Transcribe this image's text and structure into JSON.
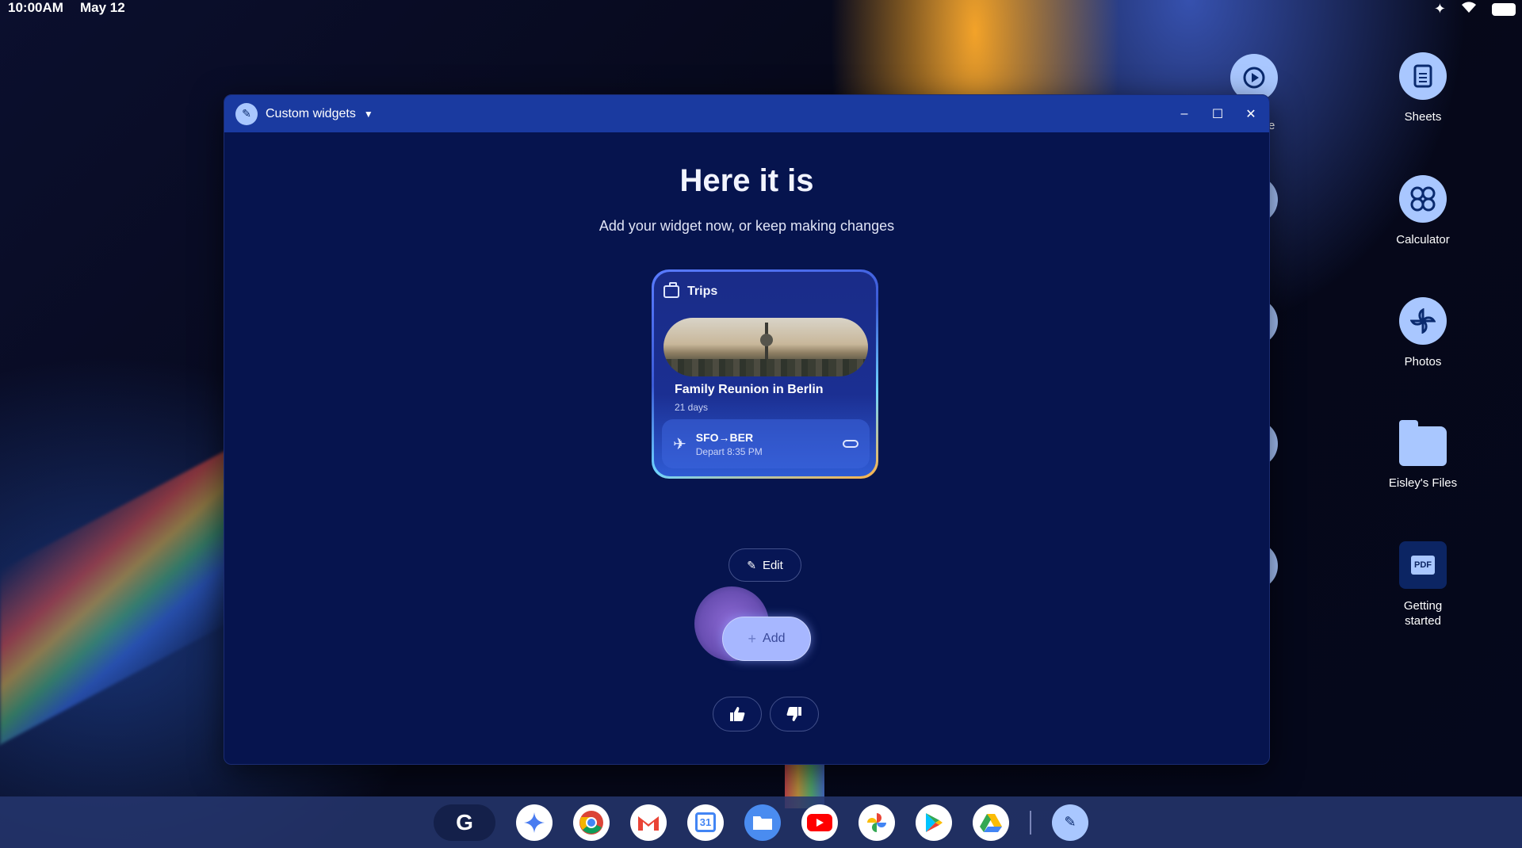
{
  "status_bar": {
    "time": "10:00AM",
    "date": "May 12",
    "icons": [
      "sparkle-icon",
      "wifi-icon",
      "battery-icon"
    ]
  },
  "desktop": {
    "items": [
      {
        "label": "Sheets",
        "icon": "sheets-icon"
      },
      {
        "label": "Calculator",
        "icon": "calculator-icon"
      },
      {
        "label": "Photos",
        "icon": "photos-icon"
      },
      {
        "label": "Eisley's Files",
        "icon": "folder-icon"
      },
      {
        "label": "Getting started",
        "icon": "pdf-icon",
        "badge": "PDF"
      }
    ],
    "partial_label": "e"
  },
  "window": {
    "title": "Custom widgets",
    "heading": "Here it is",
    "subheading": "Add your widget now, or keep making changes",
    "controls": {
      "minimize": "–",
      "maximize": "☐",
      "close": "✕"
    }
  },
  "widget": {
    "title": "Trips",
    "trip_name": "Family Reunion in Berlin",
    "trip_duration": "21 days",
    "flight_route": "SFO→BER",
    "flight_time": "Depart 8:35 PM"
  },
  "actions": {
    "edit_label": "Edit",
    "add_label": "Add"
  },
  "shelf": {
    "apps": [
      "launcher",
      "gemini",
      "chrome",
      "gmail",
      "calendar",
      "files",
      "youtube",
      "photos",
      "play-store",
      "drive",
      "custom-widgets"
    ],
    "calendar_day": "31"
  },
  "colors": {
    "window_bg": "#06144e",
    "titlebar": "#1a3aa0",
    "accent": "#a9c7ff"
  }
}
